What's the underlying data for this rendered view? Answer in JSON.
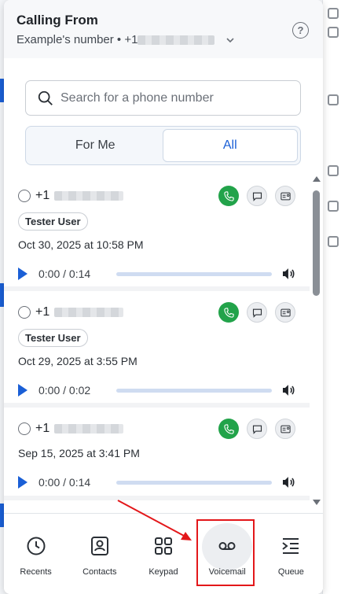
{
  "header": {
    "title": "Calling From",
    "number_prefix": "Example's number • +1",
    "help_label": "?"
  },
  "search": {
    "placeholder": "Search for a phone number"
  },
  "filter": {
    "options": [
      "For Me",
      "All"
    ],
    "selected": "All"
  },
  "voicemails": [
    {
      "number_prefix": "+1",
      "tag": "Tester User",
      "date": "Oct 30, 2025 at 10:58 PM",
      "time": "0:00 / 0:14"
    },
    {
      "number_prefix": "+1",
      "tag": "Tester User",
      "date": "Oct 29, 2025 at 3:55 PM",
      "time": "0:00 / 0:02"
    },
    {
      "number_prefix": "+1",
      "tag": "",
      "date": "Sep 15, 2025 at 3:41 PM",
      "time": "0:00 / 0:14"
    }
  ],
  "nav": {
    "items": [
      "Recents",
      "Contacts",
      "Keypad",
      "Voicemail",
      "Queue"
    ],
    "active": "Voicemail"
  },
  "colors": {
    "accent": "#1a5fd6",
    "call_green": "#22a34a",
    "highlight_red": "#e3171a"
  }
}
